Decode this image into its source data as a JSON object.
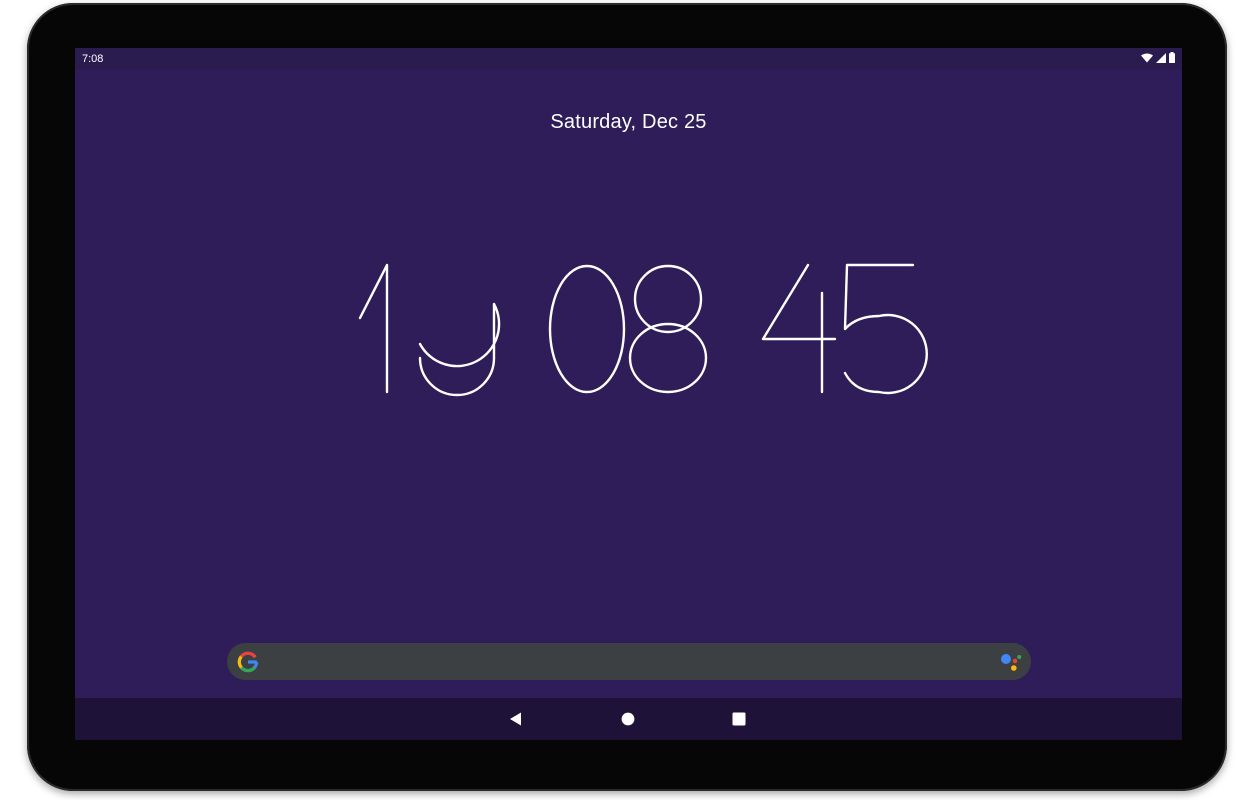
{
  "status_bar": {
    "time": "7:08",
    "icons": [
      "wifi-icon",
      "cell-signal-icon",
      "battery-icon"
    ]
  },
  "lock_screen": {
    "date": "Saturday, Dec 25",
    "clock": {
      "hours": "19",
      "minutes": "08",
      "seconds": "45"
    }
  },
  "search_bar": {
    "logo_icon": "google-g-icon",
    "assistant_icon": "google-assistant-icon"
  },
  "nav_bar": {
    "buttons": [
      "back-icon",
      "home-icon",
      "recents-icon"
    ]
  },
  "colors": {
    "screen_background": "#2f1d59",
    "status_bar": "#2b1c50",
    "nav_bar": "#1f1238",
    "search_bar": "#3c4043",
    "text": "#ffffff"
  }
}
